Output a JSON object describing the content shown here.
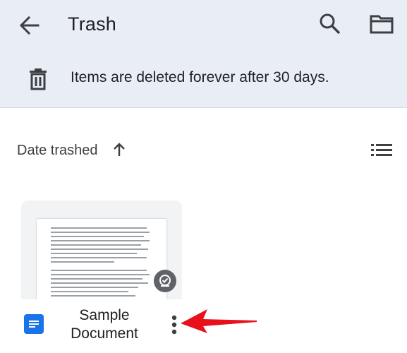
{
  "header": {
    "title": "Trash",
    "back_icon": "arrow-back-icon",
    "search_icon": "search-icon",
    "folder_icon": "folder-icon"
  },
  "banner": {
    "icon": "trash-can-icon",
    "text": "Items are deleted forever after 30 days."
  },
  "sort": {
    "label": "Date trashed",
    "direction_icon": "arrow-up-icon",
    "view_toggle_icon": "list-view-icon"
  },
  "files": [
    {
      "name_line1": "Sample",
      "name_line2": "Document",
      "type_icon": "google-docs-icon",
      "status_icon": "offline-check-icon",
      "menu_icon": "more-vertical-icon"
    }
  ],
  "annotation": {
    "color": "#e8101b",
    "icon": "red-arrow-annotation"
  },
  "colors": {
    "header_bg": "#e9eef6",
    "docs_blue": "#1a73e8",
    "icon_gray": "#3c4043"
  }
}
